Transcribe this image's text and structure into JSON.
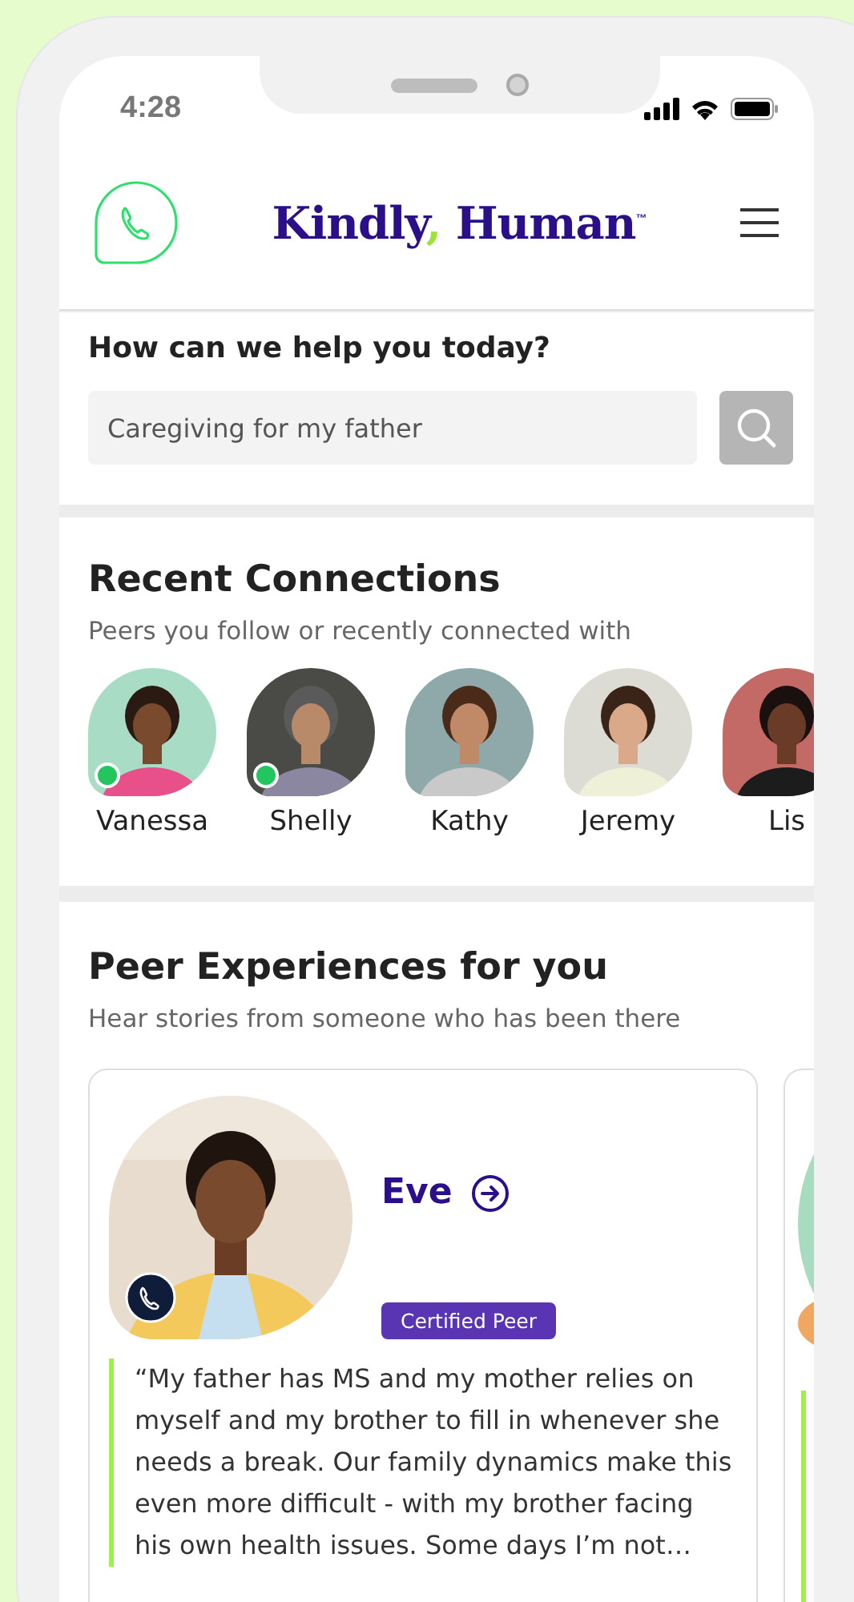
{
  "status_bar": {
    "time": "4:28"
  },
  "header": {
    "logo": {
      "parts": [
        {
          "text": "Kindly",
          "color": "#2b0e8a"
        },
        {
          "text": ",",
          "color": "#9be33a"
        },
        {
          "text": " Human",
          "color": "#2b0e8a"
        }
      ],
      "trademark": "™"
    }
  },
  "help": {
    "title": "How can we help you today?",
    "search": {
      "value": "Caregiving for my father"
    }
  },
  "recent_connections": {
    "title": "Recent Connections",
    "subtitle": "Peers you follow or recently connected with",
    "people": [
      {
        "name": "Vanessa",
        "online": true
      },
      {
        "name": "Shelly",
        "online": true
      },
      {
        "name": "Kathy",
        "online": false
      },
      {
        "name": "Jeremy",
        "online": false
      },
      {
        "name": "Lis",
        "online": false
      }
    ]
  },
  "peer_experiences": {
    "title": "Peer Experiences for you",
    "subtitle": "Hear stories from someone who has been there",
    "cards": [
      {
        "name": "Eve",
        "badge": "Certified Peer",
        "quote": "“My father has MS and my mother relies on myself and my brother to fill in whenever she needs a break. Our family dynamics make this even more difficult - with my brother facing his own health issues. Some days I’m not…"
      }
    ]
  }
}
